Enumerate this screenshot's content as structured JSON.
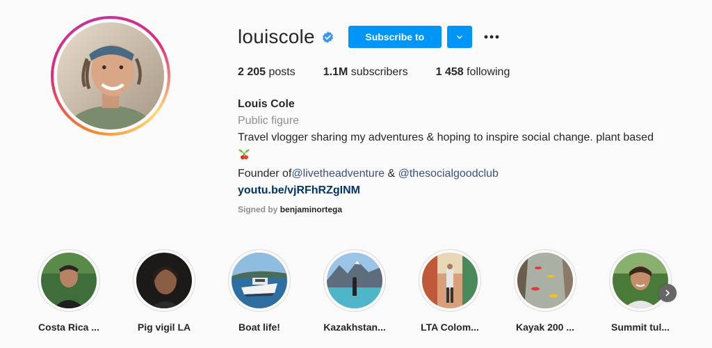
{
  "profile": {
    "username": "louiscole",
    "verified": true,
    "subscribe_label": "Subscribe to",
    "stats": {
      "posts_count": "2 205",
      "posts_label": "posts",
      "subscribers_count": "1.1M",
      "subscribers_label": "subscribers",
      "following_count": "1 458",
      "following_label": "following"
    },
    "full_name": "Louis Cole",
    "category": "Public figure",
    "bio_line1": "Travel vlogger sharing my adventures & hoping to inspire social change. plant based",
    "bio_emoji": "seedling-cherries-emoji",
    "founder_prefix": "Founder of",
    "mention1": "@livetheadventure",
    "founder_joiner": " & ",
    "mention2": "@thesocialgoodclub",
    "link": "youtu.be/vjRFhRZgINM",
    "signed_prefix": "Signed by",
    "signed_name": "benjaminortega"
  },
  "highlights": [
    {
      "label": "Costa Rica ..."
    },
    {
      "label": "Pig vigil LA"
    },
    {
      "label": "Boat life!"
    },
    {
      "label": "Kazakhstan..."
    },
    {
      "label": "LTA Colom..."
    },
    {
      "label": "Kayak 200 ..."
    },
    {
      "label": "Summit tul..."
    }
  ],
  "colors": {
    "accent": "#0095f6",
    "link": "#00376b",
    "mention": "#385185",
    "muted": "#8e8e8e",
    "text": "#262626"
  }
}
